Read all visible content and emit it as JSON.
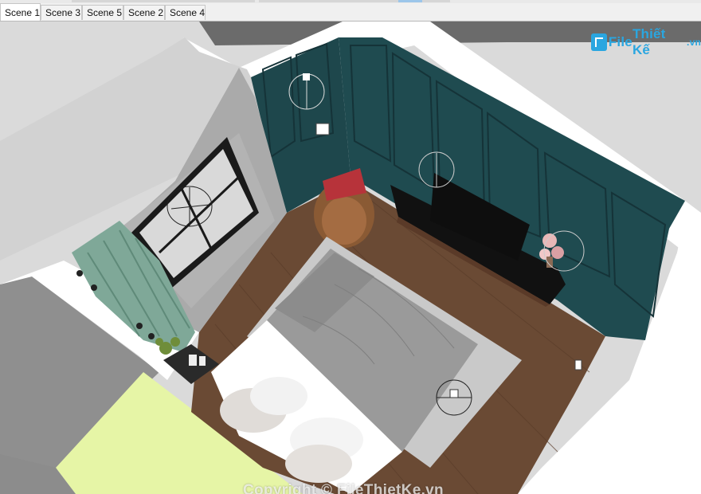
{
  "window": {
    "scene_tabs": [
      {
        "label": "Scene 1",
        "active": true
      },
      {
        "label": "Scene 3",
        "active": false
      },
      {
        "label": "Scene 5",
        "active": false
      },
      {
        "label": "Scene 2",
        "active": false
      },
      {
        "label": "Scene 4",
        "active": false
      }
    ]
  },
  "branding": {
    "logo_file": "File",
    "logo_thietke": "Thiết Kế",
    "logo_vn": ".vn",
    "watermark": "Copyright © FileThietKe.vn"
  },
  "colors": {
    "wall_panel": "#1f4b50",
    "floor_wood": "#6a4a34",
    "rug": "#c9c9c9",
    "bed_cover": "#9a9a9a",
    "curtain": "#7fa898",
    "chair_cushion": "#b7333a",
    "tv_unit": "#5a3a28",
    "yellow_floor": "#e6f5a6",
    "brand": "#2aa6e0"
  },
  "icons": {
    "logo": "filethietke-logo-icon"
  }
}
